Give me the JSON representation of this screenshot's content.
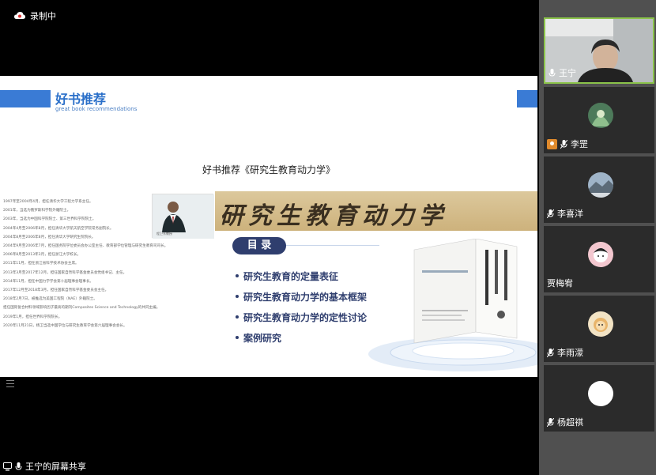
{
  "recording": {
    "label": "录制中"
  },
  "share": {
    "label": "王宁的屏幕共享"
  },
  "slide": {
    "header_title": "好书推荐",
    "header_subtitle": "great book recommendations",
    "title": "好书推荐《研究生教育动力学》",
    "banner_text": "研究生教育动力学",
    "photo_caption": "程卫东教授",
    "bio_lines": [
      "1997年至2004年4月，担任清华大学工程力学系主任。",
      "2001年，当选为俄罗斯科学院外籍院士。",
      "2003年，当选为中国科学院院士、第三世界科学院院士。",
      "2004年4月至2006年8月，担任清华大学航天航空学院常务副院长。",
      "2004年8月至2006年8月，担任清华大学研究生院院长。",
      "2004年9月至2006年7月，担任国务院学位委员会办公室主任、教育部学位管理与研究生教育司司长。",
      "2006年8月至2013年3月，担任浙江大学校长。",
      "2011年11月，担任浙江省科学技术协会主席。",
      "2013年3月至2017年12月，担任国家自然科学基金委员会党组书记、主任。",
      "2014年11月，担任中国力学学会第十届理事会理事长。",
      "2017年12月至2018年3月，担任国家自然科学基金委员会主任。",
      "2018年2月7日，被推选为美国工程院（NAE）外籍院士。",
      "担任国际复合材料领域影响因子最高的期刊Composites Science and Technology的共同主编。",
      "2019年1月，担任世界科学院院长。",
      "2020年11月21日，杨卫当选中国学位与研究生教育学会第六届理事会会长。"
    ],
    "toc_label": "目 录",
    "toc_items": [
      "研究生教育的定量表征",
      "研究生教育动力学的基本框架",
      "研究生教育动力学的定性讨论",
      "案例研究"
    ]
  },
  "participants": [
    {
      "name": "王宁"
    },
    {
      "name": "李罡"
    },
    {
      "name": "李喜洋"
    },
    {
      "name": "贾梅宥"
    },
    {
      "name": "李雨濛"
    },
    {
      "name": "杨超祺"
    }
  ],
  "colors": {
    "accent_blue": "#3a7bd5",
    "toc_navy": "#2f3e6e",
    "active_speaker": "#8bc34a",
    "panel_bg": "#505050"
  }
}
